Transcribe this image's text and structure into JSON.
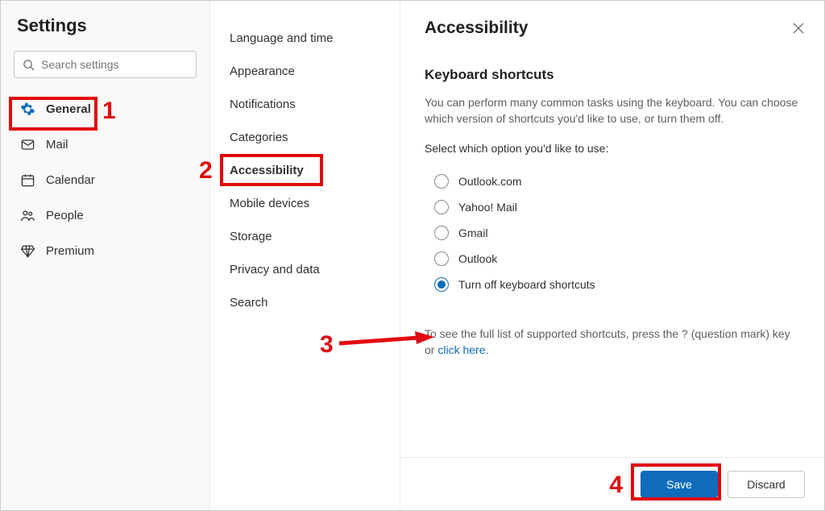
{
  "sidebar": {
    "title": "Settings",
    "search_placeholder": "Search settings",
    "items": [
      {
        "label": "General",
        "icon": "gear-icon",
        "active": true
      },
      {
        "label": "Mail",
        "icon": "mail-icon",
        "active": false
      },
      {
        "label": "Calendar",
        "icon": "calendar-icon",
        "active": false
      },
      {
        "label": "People",
        "icon": "people-icon",
        "active": false
      },
      {
        "label": "Premium",
        "icon": "diamond-icon",
        "active": false
      }
    ]
  },
  "submenu": {
    "items": [
      {
        "label": "Language and time",
        "active": false
      },
      {
        "label": "Appearance",
        "active": false
      },
      {
        "label": "Notifications",
        "active": false
      },
      {
        "label": "Categories",
        "active": false
      },
      {
        "label": "Accessibility",
        "active": true
      },
      {
        "label": "Mobile devices",
        "active": false
      },
      {
        "label": "Storage",
        "active": false
      },
      {
        "label": "Privacy and data",
        "active": false
      },
      {
        "label": "Search",
        "active": false
      }
    ]
  },
  "panel": {
    "title": "Accessibility",
    "section_heading": "Keyboard shortcuts",
    "section_desc": "You can perform many common tasks using the keyboard. You can choose which version of shortcuts you'd like to use, or turn them off.",
    "select_label": "Select which option you'd like to use:",
    "radios": [
      {
        "label": "Outlook.com",
        "selected": false
      },
      {
        "label": "Yahoo! Mail",
        "selected": false
      },
      {
        "label": "Gmail",
        "selected": false
      },
      {
        "label": "Outlook",
        "selected": false
      },
      {
        "label": "Turn off keyboard shortcuts",
        "selected": true
      }
    ],
    "help_prefix": "To see the full list of supported shortcuts, press the ? (question mark) key or ",
    "help_link": "click here",
    "help_suffix": ".",
    "save_label": "Save",
    "discard_label": "Discard"
  },
  "annotations": {
    "n1": "1",
    "n2": "2",
    "n3": "3",
    "n4": "4"
  }
}
